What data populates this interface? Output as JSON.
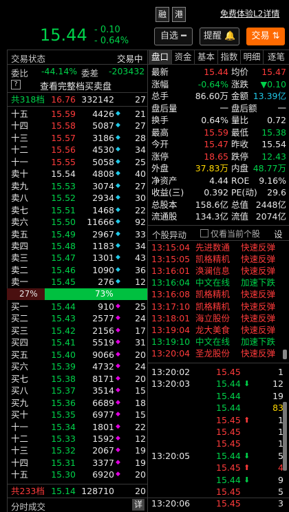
{
  "header": {
    "price": "15.44",
    "change": "- 0.10",
    "change_pct": "- 0.64%",
    "btn_rong": "融",
    "btn_gang": "港",
    "free_l2": "免费体验L2详情",
    "zixuan": "自选",
    "remind": "提醒",
    "trade": "交易"
  },
  "left": {
    "status_label": "交易状态",
    "status_value": "交易中",
    "wb_label": "委比",
    "wb_value": "-44.14%",
    "wc_label": "委差",
    "wc_value": "-203432",
    "help": "?",
    "full_book": "查看完整档买卖盘",
    "sell_total": {
      "label": "共318档",
      "price": "16.76",
      "vol": "332142",
      "cnt": "27"
    },
    "sells": [
      {
        "lab": "十五",
        "price": "15.59",
        "vol": "4426",
        "cnt": "21"
      },
      {
        "lab": "十四",
        "price": "15.58",
        "vol": "5087",
        "cnt": "27"
      },
      {
        "lab": "十三",
        "price": "15.57",
        "vol": "3186",
        "cnt": "28"
      },
      {
        "lab": "十二",
        "price": "15.56",
        "vol": "4530",
        "cnt": "34"
      },
      {
        "lab": "十一",
        "price": "15.55",
        "vol": "5058",
        "cnt": "25"
      },
      {
        "lab": "卖十",
        "price": "15.54",
        "vol": "4808",
        "cnt": "40"
      },
      {
        "lab": "卖九",
        "price": "15.53",
        "vol": "3074",
        "cnt": "27"
      },
      {
        "lab": "卖八",
        "price": "15.52",
        "vol": "2934",
        "cnt": "30"
      },
      {
        "lab": "卖七",
        "price": "15.51",
        "vol": "1468",
        "cnt": "22"
      },
      {
        "lab": "卖六",
        "price": "15.50",
        "vol": "11666",
        "cnt": "92"
      },
      {
        "lab": "卖五",
        "price": "15.49",
        "vol": "2967",
        "cnt": "33"
      },
      {
        "lab": "卖四",
        "price": "15.48",
        "vol": "1183",
        "cnt": "34"
      },
      {
        "lab": "卖三",
        "price": "15.47",
        "vol": "1301",
        "cnt": "43"
      },
      {
        "lab": "卖二",
        "price": "15.46",
        "vol": "1090",
        "cnt": "36"
      },
      {
        "lab": "卖一",
        "price": "15.45",
        "vol": "276",
        "cnt": "12"
      }
    ],
    "ratio_sell": "27%",
    "ratio_buy": "73%",
    "ratio_sell_frac": 0.27,
    "buys": [
      {
        "lab": "买一",
        "price": "15.44",
        "vol": "910",
        "cnt": "25"
      },
      {
        "lab": "买二",
        "price": "15.43",
        "vol": "2577",
        "cnt": "24"
      },
      {
        "lab": "买三",
        "price": "15.42",
        "vol": "2156",
        "cnt": "17"
      },
      {
        "lab": "买四",
        "price": "15.41",
        "vol": "5519",
        "cnt": "31"
      },
      {
        "lab": "买五",
        "price": "15.40",
        "vol": "9066",
        "cnt": "20"
      },
      {
        "lab": "买六",
        "price": "15.39",
        "vol": "4732",
        "cnt": "24"
      },
      {
        "lab": "买七",
        "price": "15.38",
        "vol": "8171",
        "cnt": "20"
      },
      {
        "lab": "买八",
        "price": "15.37",
        "vol": "3514",
        "cnt": "15"
      },
      {
        "lab": "买九",
        "price": "15.36",
        "vol": "6689",
        "cnt": "18"
      },
      {
        "lab": "买十",
        "price": "15.35",
        "vol": "6977",
        "cnt": "15"
      },
      {
        "lab": "十一",
        "price": "15.34",
        "vol": "1801",
        "cnt": "22"
      },
      {
        "lab": "十二",
        "price": "15.33",
        "vol": "1592",
        "cnt": "12"
      },
      {
        "lab": "十三",
        "price": "15.32",
        "vol": "2067",
        "cnt": "19"
      },
      {
        "lab": "十四",
        "price": "15.31",
        "vol": "3377",
        "cnt": "19"
      },
      {
        "lab": "十五",
        "price": "15.30",
        "vol": "6920",
        "cnt": "20"
      }
    ],
    "buy_total": {
      "label": "共233档",
      "price": "15.14",
      "vol": "128710",
      "cnt": "20"
    },
    "footer": "分时成交",
    "footer_btn": "详"
  },
  "right": {
    "tabs": [
      "盘口",
      "资金",
      "基本",
      "指数",
      "明细",
      "逐笔"
    ],
    "quote": [
      [
        "最新",
        "15.44",
        "red",
        "均价",
        "15.47",
        "red"
      ],
      [
        "涨幅",
        "-0.64%",
        "green",
        "涨跌",
        "▼0.10",
        "green"
      ],
      [
        "总手",
        "86.60万",
        "white",
        "金额",
        "13.39亿",
        "cyan"
      ],
      [
        "盘后量",
        "一",
        "white",
        "盘后额",
        "一",
        "white"
      ],
      [
        "换手",
        "0.64%",
        "white",
        "量比",
        "0.72",
        "white"
      ],
      [
        "最高",
        "15.59",
        "red",
        "最低",
        "15.38",
        "green"
      ],
      [
        "今开",
        "15.47",
        "red",
        "昨收",
        "15.54",
        "white"
      ],
      [
        "涨停",
        "18.65",
        "red",
        "跌停",
        "12.43",
        "green"
      ],
      [
        "外盘",
        "37.83万",
        "yellow",
        "内盘",
        "48.77万",
        "green"
      ],
      [
        "净资产",
        "4.44",
        "white",
        "ROE",
        "9.16%",
        "white"
      ],
      [
        "收益(三)",
        "0.392",
        "white",
        "PE(动)",
        "29.6",
        "white"
      ],
      [
        "总股本",
        "158.6亿",
        "white",
        "总值",
        "2448亿",
        "white"
      ],
      [
        "流通股",
        "134.3亿",
        "white",
        "流值",
        "2074亿",
        "white"
      ]
    ],
    "alert_title": "个股异动",
    "alert_check": "仅看当前个股",
    "alert_settings": "设",
    "alerts": [
      [
        "13:15:04",
        "先进数通",
        "快速反弹",
        "red"
      ],
      [
        "13:15:05",
        "凯格精机",
        "快速反弹",
        "red"
      ],
      [
        "13:16:01",
        "涣澜信息",
        "快速反弹",
        "red"
      ],
      [
        "13:16:04",
        "中文在线",
        "加速下跌",
        "green"
      ],
      [
        "13:16:08",
        "凯格精机",
        "快速反弹",
        "red"
      ],
      [
        "13:17:10",
        "凯格精机",
        "快速反弹",
        "red"
      ],
      [
        "13:18:01",
        "海立股份",
        "快速反弹",
        "red"
      ],
      [
        "13:19:04",
        "龙大美食",
        "快速反弹",
        "red"
      ],
      [
        "13:19:10",
        "中文在线",
        "加速下跌",
        "green"
      ],
      [
        "13:20:04",
        "圣龙股份",
        "快速反弹",
        "red"
      ]
    ],
    "ticks": [
      [
        "13:20:02",
        "15.45",
        "",
        "1",
        "red",
        "white"
      ],
      [
        "13:20:03",
        "15.44",
        "⬇",
        "12",
        "green",
        "white"
      ],
      [
        "",
        "15.44",
        "",
        "19",
        "green",
        "white"
      ],
      [
        "",
        "15.44",
        "",
        "83",
        "green",
        "yellow"
      ],
      [
        "",
        "15.45",
        "⬆",
        "1",
        "red",
        "white"
      ],
      [
        "",
        "15.45",
        "",
        "1",
        "red",
        "white"
      ],
      [
        "",
        "15.45",
        "",
        "1",
        "red",
        "white"
      ],
      [
        "13:20:05",
        "15.44",
        "⬇",
        "5",
        "green",
        "white"
      ],
      [
        "",
        "15.45",
        "⬆",
        "4",
        "red",
        "red"
      ],
      [
        "",
        "15.44",
        "⬇",
        "9",
        "green",
        "white"
      ],
      [
        "",
        "15.45",
        "",
        "5",
        "red",
        "white"
      ],
      [
        "13:20:06",
        "15.45",
        "",
        "3",
        "red",
        "white"
      ]
    ]
  }
}
